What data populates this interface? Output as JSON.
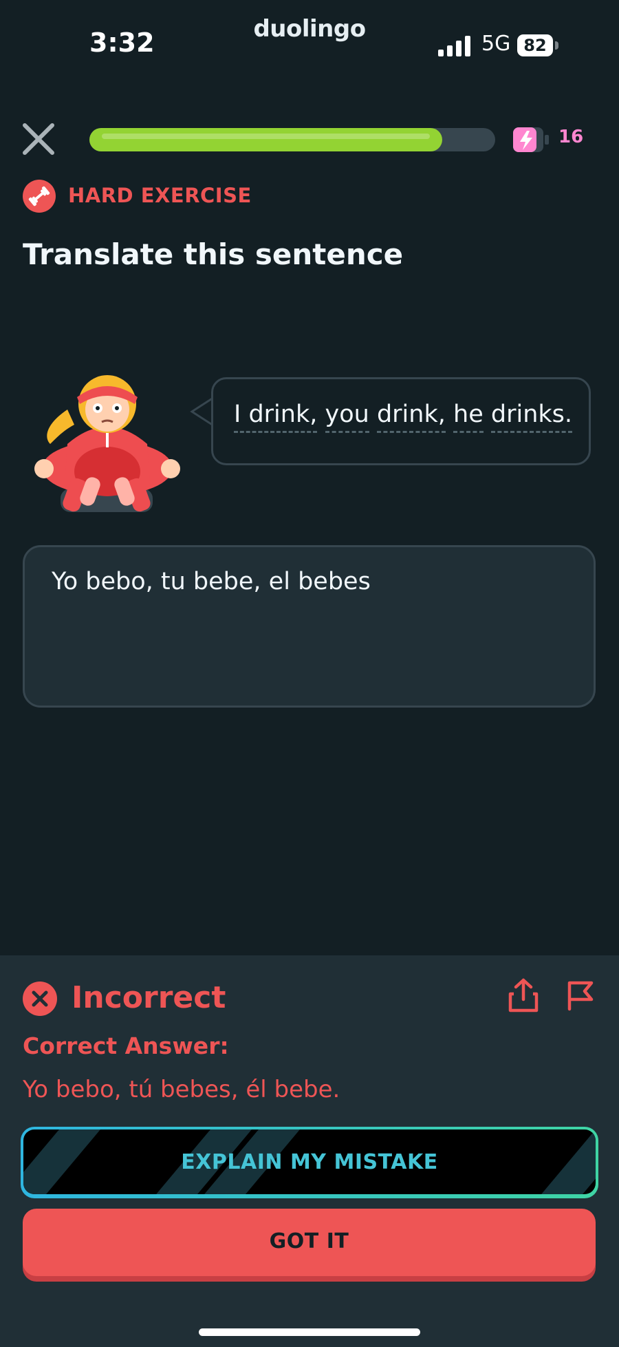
{
  "status_bar": {
    "time": "3:32",
    "app_name": "duolingo",
    "network": "5G",
    "battery": "82"
  },
  "lesson": {
    "progress": 0.87,
    "energy_count": "16",
    "difficulty_label": "HARD EXERCISE",
    "prompt_title": "Translate this sentence",
    "sentence_words": [
      "I drink,",
      "you",
      "drink,",
      "he",
      "drinks."
    ],
    "user_answer": "Yo bebo, tu bebe, el bebes"
  },
  "feedback": {
    "title": "Incorrect",
    "correct_label": "Correct Answer:",
    "correct_answer": "Yo bebo, tú bebes, él bebe.",
    "explain_button": "EXPLAIN MY MISTAKE",
    "got_it_button": "GOT IT"
  },
  "colors": {
    "background": "#131f24",
    "panel": "#202f36",
    "accent_green": "#93d333",
    "error_red": "#ee5555",
    "energy_pink": "#ff86d0"
  },
  "icons": [
    "close-icon",
    "energy-icon",
    "dumbbell-icon",
    "x-circle-icon",
    "share-icon",
    "flag-icon"
  ]
}
